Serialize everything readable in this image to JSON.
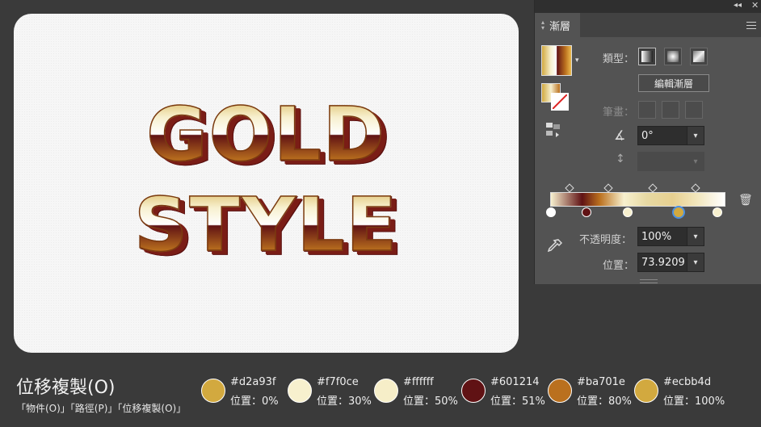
{
  "canvas": {
    "line1": "GOLD",
    "line2": "STYLE"
  },
  "panel": {
    "title": "漸層",
    "type_label": "類型：",
    "edit_gradient_label": "編輯漸層",
    "stroke_label": "筆畫：",
    "angle_value": "0°",
    "aspect_value": "",
    "opacity_label": "不透明度：",
    "opacity_value": "100%",
    "location_label": "位置：",
    "location_value": "73.9209"
  },
  "caption": {
    "title": "位移複製(O)",
    "subtitle": "「物件(O)」「路徑(P)」「位移複製(O)」",
    "stops": [
      {
        "hex": "#d2a93f",
        "pos": "位置：0%",
        "color": "#d2a93f"
      },
      {
        "hex": "#f7f0ce",
        "pos": "位置：30%",
        "color": "#f7f0ce"
      },
      {
        "hex": "#ffffff",
        "pos": "位置：50%",
        "color": "#f6eec8"
      },
      {
        "hex": "#601214",
        "pos": "位置：51%",
        "color": "#601214"
      },
      {
        "hex": "#ba701e",
        "pos": "位置：80%",
        "color": "#ba701e"
      },
      {
        "hex": "#ecbb4d",
        "pos": "位置：100%",
        "color": "#d2a93f"
      }
    ]
  }
}
